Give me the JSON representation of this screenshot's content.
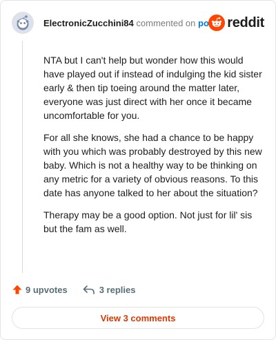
{
  "comment": {
    "username": "ElectronicZucchini84",
    "action_text": "commented on",
    "post_link": "post",
    "paragraphs": [
      "NTA but I can't help but wonder how this would have played out if instead of indulging the kid sister early & then tip toeing around the matter later, everyone was just direct with her once it became uncomfortable for you.",
      "For all she knows, she had a chance to be happy with you which was probably destroyed by this new baby. Which is not a healthy way to be thinking on any metric for a variety of obvious reasons. To this date has anyone talked to her about the situation?",
      "Therapy may be a good option. Not just for lil' sis but the fam as well."
    ]
  },
  "brand": {
    "wordmark": "reddit",
    "color": "#ff4500"
  },
  "actions": {
    "upvotes": "9 upvotes",
    "replies": "3 replies",
    "view_comments": "View 3 comments"
  },
  "icons": {
    "avatar": "snoo-avatar-icon",
    "logo": "reddit-logo-icon",
    "upvote": "upvote-arrow-icon",
    "reply": "reply-arrow-icon"
  },
  "colors": {
    "upvote": "#ff4500",
    "link": "#0079d3",
    "view_comments": "#d93900"
  }
}
